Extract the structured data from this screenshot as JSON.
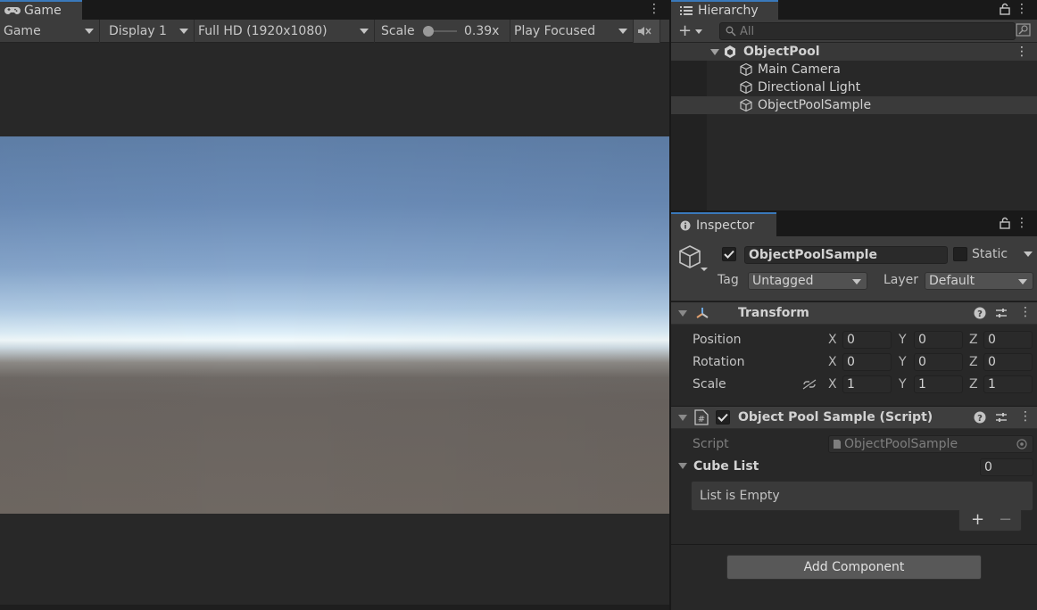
{
  "game": {
    "tab_label": "Game",
    "toolbar": {
      "view_mode": "Game",
      "display": "Display 1",
      "resolution": "Full HD (1920x1080)",
      "scale_label": "Scale",
      "scale_value": "0.39x",
      "scale_fraction": 0.1,
      "play_mode": "Play Focused"
    }
  },
  "hierarchy": {
    "tab_label": "Hierarchy",
    "search_placeholder": "All",
    "scene": "ObjectPool",
    "items": [
      "Main Camera",
      "Directional Light",
      "ObjectPoolSample"
    ],
    "selected_item": "ObjectPoolSample"
  },
  "inspector": {
    "tab_label": "Inspector",
    "object_name": "ObjectPoolSample",
    "active": true,
    "static_label": "Static",
    "static_checked": false,
    "tag_label": "Tag",
    "tag_value": "Untagged",
    "layer_label": "Layer",
    "layer_value": "Default",
    "transform": {
      "title": "Transform",
      "position_label": "Position",
      "rotation_label": "Rotation",
      "scale_label": "Scale",
      "axis_x": "X",
      "axis_y": "Y",
      "axis_z": "Z",
      "position": {
        "x": "0",
        "y": "0",
        "z": "0"
      },
      "rotation": {
        "x": "0",
        "y": "0",
        "z": "0"
      },
      "scale": {
        "x": "1",
        "y": "1",
        "z": "1"
      }
    },
    "script_component": {
      "title": "Object Pool Sample (Script)",
      "enabled": true,
      "script_label": "Script",
      "script_value": "ObjectPoolSample",
      "list_label": "Cube List",
      "list_count": "0",
      "empty_text": "List is Empty",
      "add_symbol": "+",
      "remove_symbol": "−"
    },
    "add_component_label": "Add Component"
  },
  "colors": {
    "accent": "#3a79bb",
    "panel_bg": "#282828",
    "toolbar_bg": "#3c3c3c"
  }
}
